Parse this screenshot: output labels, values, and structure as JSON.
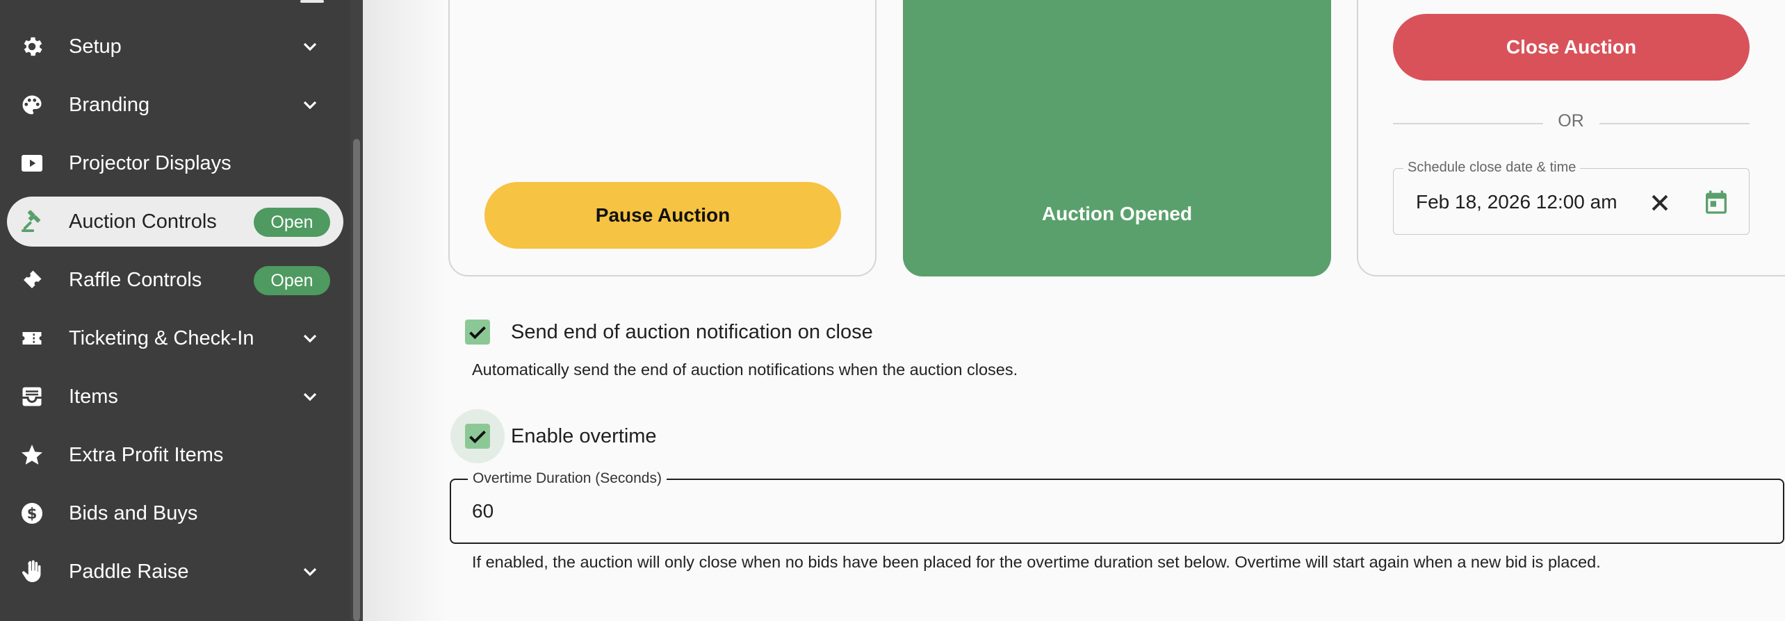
{
  "sidebar": {
    "items": [
      {
        "label": "Setup",
        "icon": "gear-icon",
        "chevron": true
      },
      {
        "label": "Branding",
        "icon": "palette-icon",
        "chevron": true
      },
      {
        "label": "Projector Displays",
        "icon": "play-screen-icon"
      },
      {
        "label": "Auction Controls",
        "icon": "gavel-icon",
        "badge": "Open",
        "active": true
      },
      {
        "label": "Raffle Controls",
        "icon": "ticket-icon",
        "badge": "Open"
      },
      {
        "label": "Ticketing & Check-In",
        "icon": "ticket-stub-icon",
        "chevron": true
      },
      {
        "label": "Items",
        "icon": "inbox-tray-icon",
        "chevron": true
      },
      {
        "label": "Extra Profit Items",
        "icon": "star-icon"
      },
      {
        "label": "Bids and Buys",
        "icon": "dollar-circle-icon"
      },
      {
        "label": "Paddle Raise",
        "icon": "hand-icon",
        "chevron": true
      }
    ]
  },
  "controls": {
    "pause_label": "Pause Auction",
    "opened_label": "Auction Opened",
    "close_label": "Close Auction",
    "or_text": "OR",
    "schedule": {
      "label": "Schedule close date & time",
      "value": "Feb 18, 2026 12:00 am"
    }
  },
  "notification": {
    "checked": true,
    "label": "Send end of auction notification on close",
    "helper": "Automatically send the end of auction notifications when the auction closes."
  },
  "overtime": {
    "checked": true,
    "label": "Enable overtime",
    "field_label": "Overtime Duration (Seconds)",
    "field_value": "60",
    "helper": "If enabled, the auction will only close when no bids have been placed for the overtime duration set below. Overtime will start again when a new bid is placed."
  },
  "colors": {
    "sidebar_bg": "#3d3d3d",
    "accent_green": "#5aa06c",
    "pause_yellow": "#f6c342",
    "close_red": "#d9525a"
  }
}
